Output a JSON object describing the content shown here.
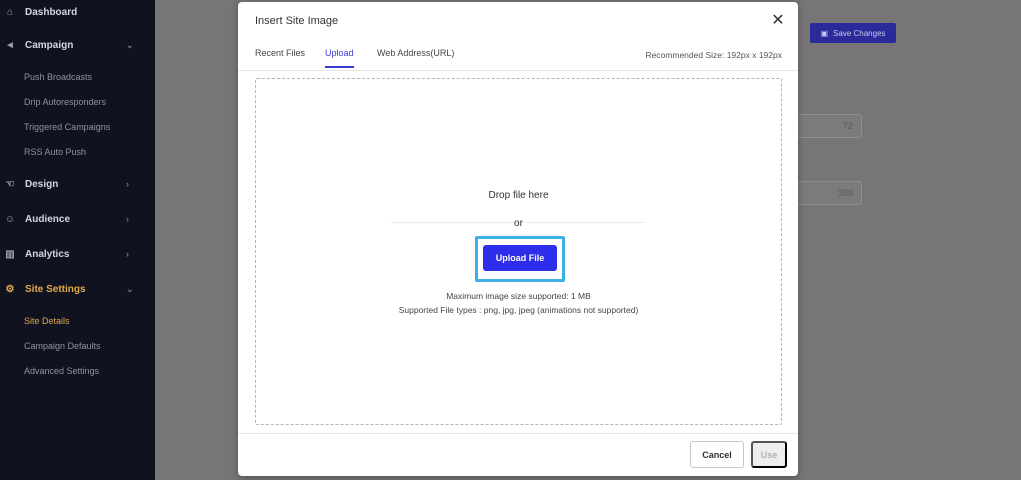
{
  "sidebar": {
    "items": [
      {
        "label": "Dashboard",
        "icon": "home-icon"
      },
      {
        "label": "Campaign",
        "icon": "megaphone-icon"
      },
      {
        "label": "Design",
        "icon": "hand-icon"
      },
      {
        "label": "Audience",
        "icon": "users-icon"
      },
      {
        "label": "Analytics",
        "icon": "bar-chart-icon"
      },
      {
        "label": "Site Settings",
        "icon": "gear-icon"
      }
    ],
    "campaign_sub": [
      "Push Broadcasts",
      "Drip Autoresponders",
      "Triggered Campaigns",
      "RSS Auto Push"
    ],
    "settings_sub": [
      "Site Details",
      "Campaign Defaults",
      "Advanced Settings"
    ]
  },
  "main": {
    "save_label": "Save Changes",
    "field1_value": "72",
    "field2_value": "388"
  },
  "modal": {
    "title": "Insert Site Image",
    "tabs": [
      "Recent Files",
      "Upload",
      "Web Address(URL)"
    ],
    "active_tab": "Upload",
    "recommended_size": "Recommended Size: 192px x 192px",
    "drop_text": "Drop file here",
    "or_text": "or",
    "upload_label": "Upload File",
    "max_size": "Maximum image size supported: 1 MB",
    "file_types": "Supported File types : png, jpg, jpeg (animations not supported)",
    "cancel_label": "Cancel",
    "use_label": "Use"
  },
  "colors": {
    "accent": "#2d2dea",
    "highlight": "#3eaee8",
    "sidebar_bg": "#10131f",
    "active_nav": "#e2a94a"
  }
}
